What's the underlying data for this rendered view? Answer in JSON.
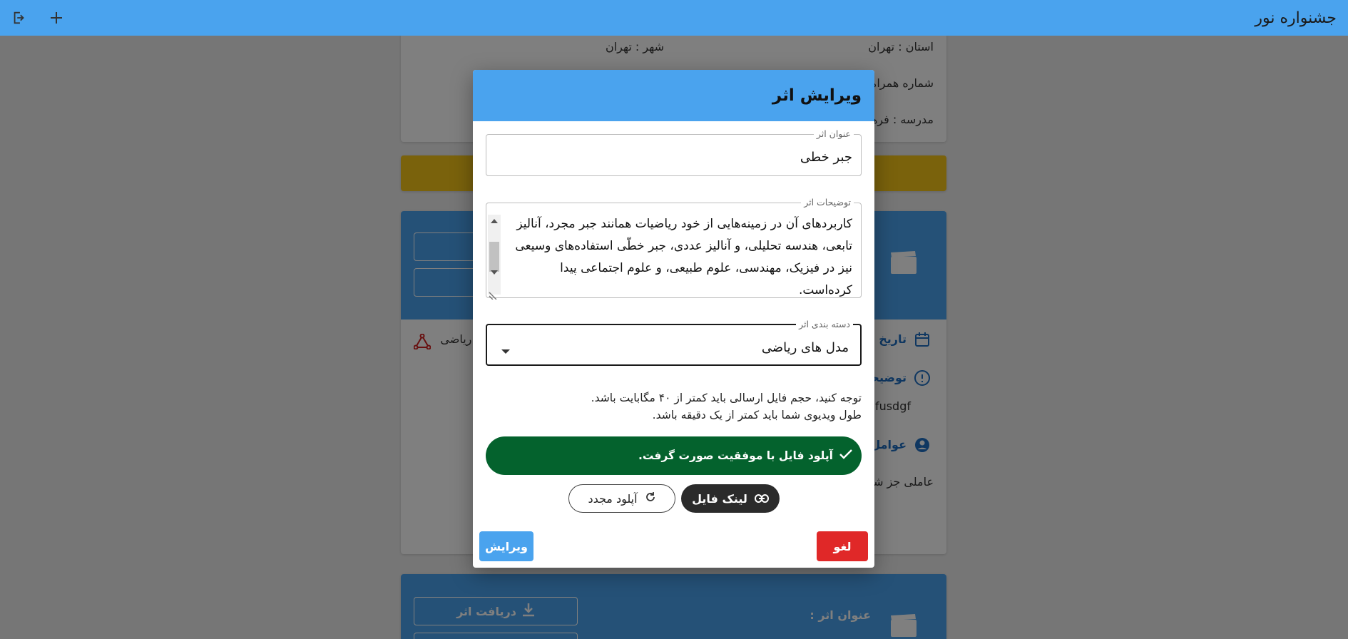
{
  "app": {
    "title": "جشنواره نور"
  },
  "background": {
    "province": "استان : تهران",
    "city": "شهر : تهران",
    "phone": "شماره همراه :",
    "school": "مدرسه : فرهنگ",
    "date_label": "تاریخ ار",
    "desc_label": "توضیحا",
    "desc_value": "nfusdgf",
    "agents_label": "عوامل:",
    "agents_value": "عاملی جز شم",
    "category_value": "ی ریاضی",
    "download_button": "دریافت اثر",
    "work_title_label": "عنوان اثر :"
  },
  "dialog": {
    "title": "ویرایش اثر",
    "title_field": {
      "label": "عنوان اثر",
      "value": "جبر خطی"
    },
    "description_field": {
      "label": "توضیحات اثر",
      "value": "کاربردهای آن در زمینه‌هایی از خود ریاضیات همانند جبر مجرد، آنالیز تابعی، هندسه تحلیلی، و آنالیز عددی، جبر خطّی استفاده‌های وسیعی نیز در فیزیک، مهندسی، علوم طبیعی، و علوم اجتماعی پیدا کرده‌است."
    },
    "category_field": {
      "label": "دسته بندی اثر",
      "value": "مدل های ریاضی"
    },
    "notes": [
      "توجه کنید، حجم فایل ارسالی باید کمتر از ۴۰ مگابایت باشد.",
      "طول ویدیوی شما باید کمتر از یک دقیقه باشد."
    ],
    "upload_success": "آپلود فایل با موفقیت صورت گرفت.",
    "file_link_button": "لینک فایل",
    "reupload_button": "آپلود مجدد",
    "cancel_button": "لغو",
    "edit_button": "ویرایش"
  },
  "colors": {
    "primary": "#4aa3ee",
    "success": "#04622d",
    "danger": "#e02828",
    "warning": "#f5c518"
  },
  "icons": {
    "logout": "logout-icon",
    "add": "plus-icon",
    "check": "check-icon",
    "link": "link-icon",
    "refresh": "refresh-icon",
    "calendar": "calendar-icon",
    "info": "info-icon",
    "person": "person-icon",
    "film": "clapperboard-icon",
    "download": "download-icon",
    "category": "share-nodes-icon"
  }
}
